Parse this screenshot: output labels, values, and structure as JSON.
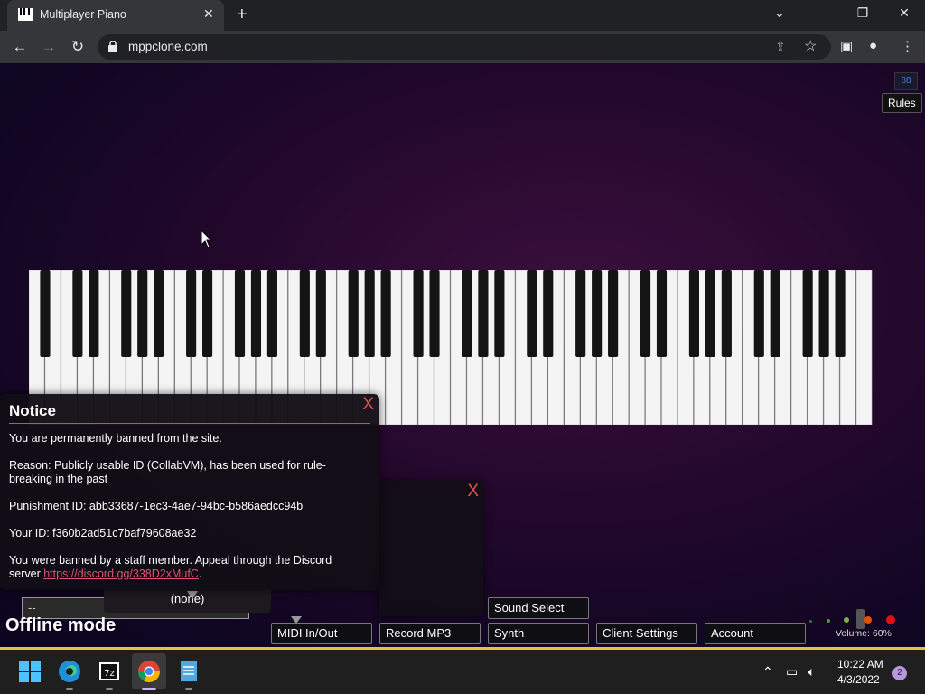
{
  "browser": {
    "tab_title": "Multiplayer Piano",
    "tab_close": "✕",
    "new_tab": "+",
    "url": "mppclone.com",
    "win_minimize": "–",
    "win_restore": "❐",
    "win_close": "✕",
    "tab_search": "⌄",
    "back": "←",
    "forward": "→",
    "reload": "↻"
  },
  "page": {
    "rules_tooltip": "Rules",
    "rules_icon": "88",
    "notice": {
      "title": "Notice",
      "close": "X",
      "line1": "You are permanently banned from the site.",
      "line2": "Reason: Publicly usable ID (CollabVM), has been used for rule-breaking in the past",
      "line3": "Punishment ID: abb33687-1ec3-4ae7-94bc-b586aedcc94b",
      "line4": "Your ID: f360b2ad51c7baf79608ae32",
      "line5_prefix": "You were banned by a staff member. Appeal through the Discord server ",
      "line5_link": "https://discord.gg/338D2xMufC",
      "line5_suffix": "."
    },
    "modal2_close": "X",
    "chat_input": "--",
    "room_select": "(none)",
    "offline_mode": "Offline mode",
    "buttons": {
      "sound_select": "Sound Select",
      "midi": "MIDI In/Out",
      "record": "Record MP3",
      "synth": "Synth",
      "client_settings": "Client Settings",
      "account": "Account"
    },
    "volume_label": "Volume: 60%",
    "volume_level": 0.6
  },
  "taskbar": {
    "time": "10:22 AM",
    "date": "4/3/2022",
    "notifications": "2",
    "apps": [
      "start-icon",
      "edge-icon",
      "7zip-icon",
      "chrome-icon",
      "notepad-icon"
    ]
  },
  "colors": {
    "accent_line": "#b8602a",
    "close_red": "#e05050",
    "link": "#e05070",
    "taskbar_accent": "#e7c33a"
  }
}
